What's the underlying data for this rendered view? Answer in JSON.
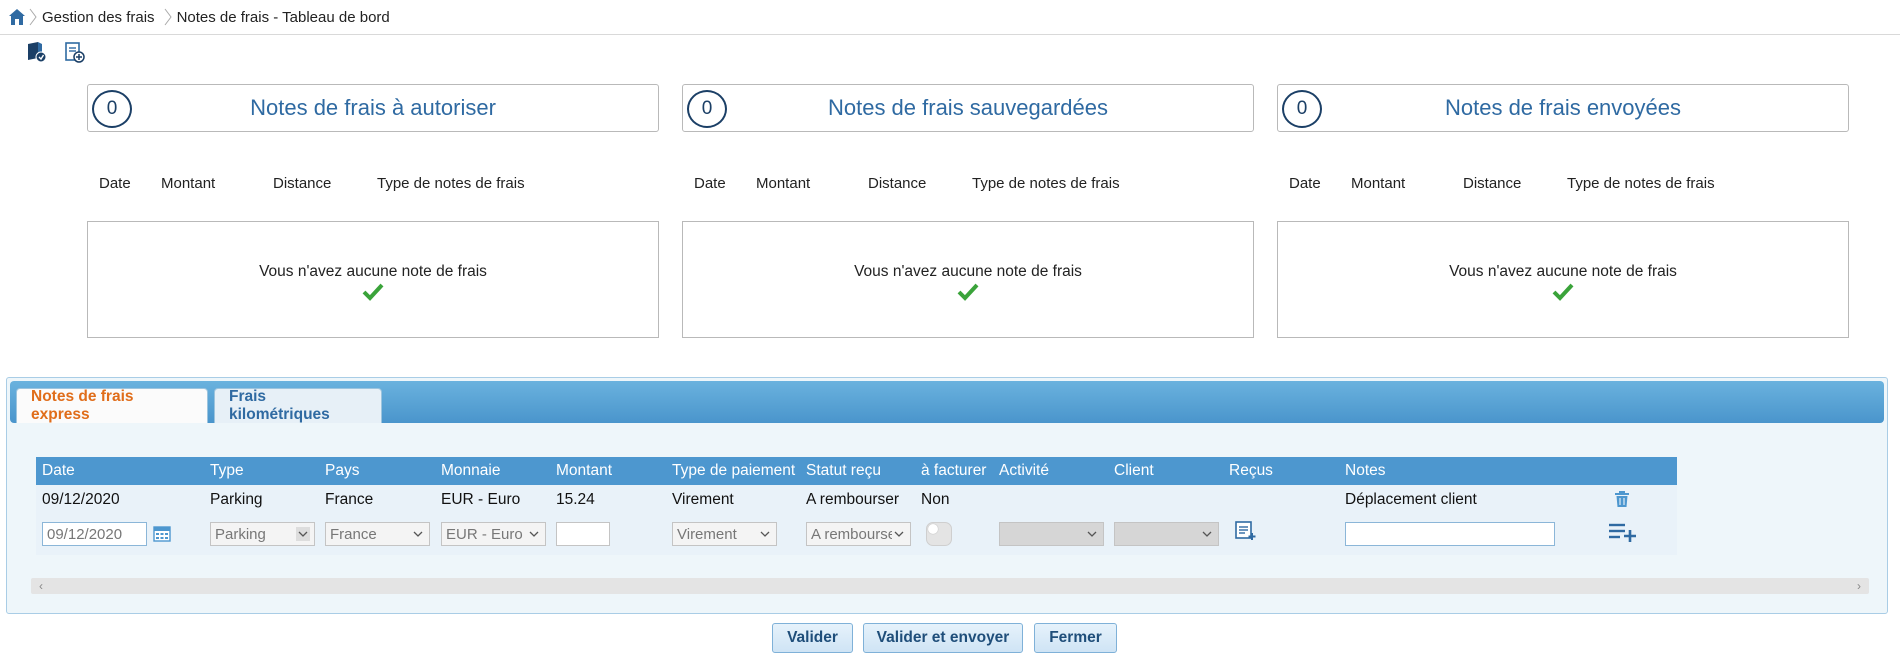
{
  "breadcrumb": {
    "items": [
      "Gestion des frais",
      "Notes de frais - Tableau de bord"
    ]
  },
  "toolbar": {
    "icons": [
      "receipt-book-icon",
      "new-note-icon"
    ]
  },
  "cards": [
    {
      "count": "0",
      "title": "Notes de frais à autoriser",
      "columns": [
        "Date",
        "Montant",
        "Distance",
        "Type de notes de frais"
      ],
      "empty_message": "Vous n'avez aucune note de frais"
    },
    {
      "count": "0",
      "title": "Notes de frais sauvegardées",
      "columns": [
        "Date",
        "Montant",
        "Distance",
        "Type de notes de frais"
      ],
      "empty_message": "Vous n'avez aucune note de frais"
    },
    {
      "count": "0",
      "title": "Notes de frais envoyées",
      "columns": [
        "Date",
        "Montant",
        "Distance",
        "Type de notes de frais"
      ],
      "empty_message": "Vous n'avez aucune note de frais"
    }
  ],
  "tabs": [
    {
      "label": "Notes de frais express",
      "active": true
    },
    {
      "label": "Frais kilométriques",
      "active": false
    }
  ],
  "grid": {
    "headers": [
      "Date",
      "Type",
      "Pays",
      "Monnaie",
      "Montant",
      "Type de paiement",
      "Statut reçu",
      "à facturer",
      "Activité",
      "Client",
      "Reçus",
      "Notes"
    ],
    "row": {
      "date": "09/12/2020",
      "type": "Parking",
      "pays": "France",
      "monnaie": "EUR - Euro",
      "montant": "15.24",
      "paiement": "Virement",
      "statut": "A rembourser",
      "facturer": "Non",
      "activite": "",
      "client": "",
      "notes": "Déplacement client"
    },
    "edit": {
      "date": "09/12/2020",
      "type": "Parking",
      "pays": "France",
      "monnaie": "EUR - Euro",
      "montant": "",
      "paiement": "Virement",
      "statut": "A rembourser",
      "activite": "",
      "client": "",
      "notes": ""
    }
  },
  "buttons": {
    "valider": "Valider",
    "valider_envoyer": "Valider et envoyer",
    "fermer": "Fermer"
  },
  "colors": {
    "accent_blue": "#2f6aa2",
    "grid_header": "#4d97cf",
    "active_tab": "#e06d1a",
    "check_green": "#3aa33a"
  }
}
